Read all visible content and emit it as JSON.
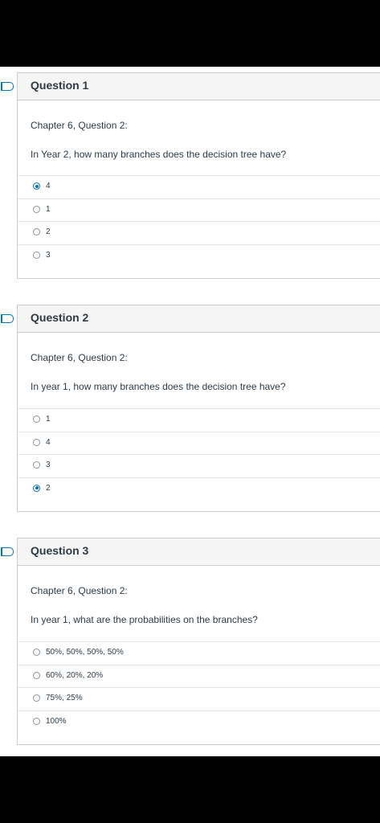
{
  "questions": [
    {
      "title": "Question 1",
      "chapter": "Chapter 6, Question 2:",
      "text": "In Year 2, how many branches does the decision tree have?",
      "answers": [
        {
          "label": "4",
          "selected": true
        },
        {
          "label": "1",
          "selected": false
        },
        {
          "label": "2",
          "selected": false
        },
        {
          "label": "3",
          "selected": false
        }
      ]
    },
    {
      "title": "Question 2",
      "chapter": "Chapter 6, Question 2:",
      "text": "In year 1, how many branches does the decision tree have?",
      "answers": [
        {
          "label": "1",
          "selected": false
        },
        {
          "label": "4",
          "selected": false
        },
        {
          "label": "3",
          "selected": false
        },
        {
          "label": "2",
          "selected": true
        }
      ]
    },
    {
      "title": "Question 3",
      "chapter": "Chapter 6, Question 2:",
      "text": "In year 1, what are the probabilities on the branches?",
      "answers": [
        {
          "label": "50%, 50%, 50%, 50%",
          "selected": false
        },
        {
          "label": "60%, 20%, 20%",
          "selected": false
        },
        {
          "label": "75%, 25%",
          "selected": false
        },
        {
          "label": "100%",
          "selected": false
        }
      ]
    }
  ],
  "colors": {
    "accent": "#0374b5",
    "text": "#2d3b45",
    "border": "#c7cdd1",
    "header_bg": "#f5f5f5"
  }
}
